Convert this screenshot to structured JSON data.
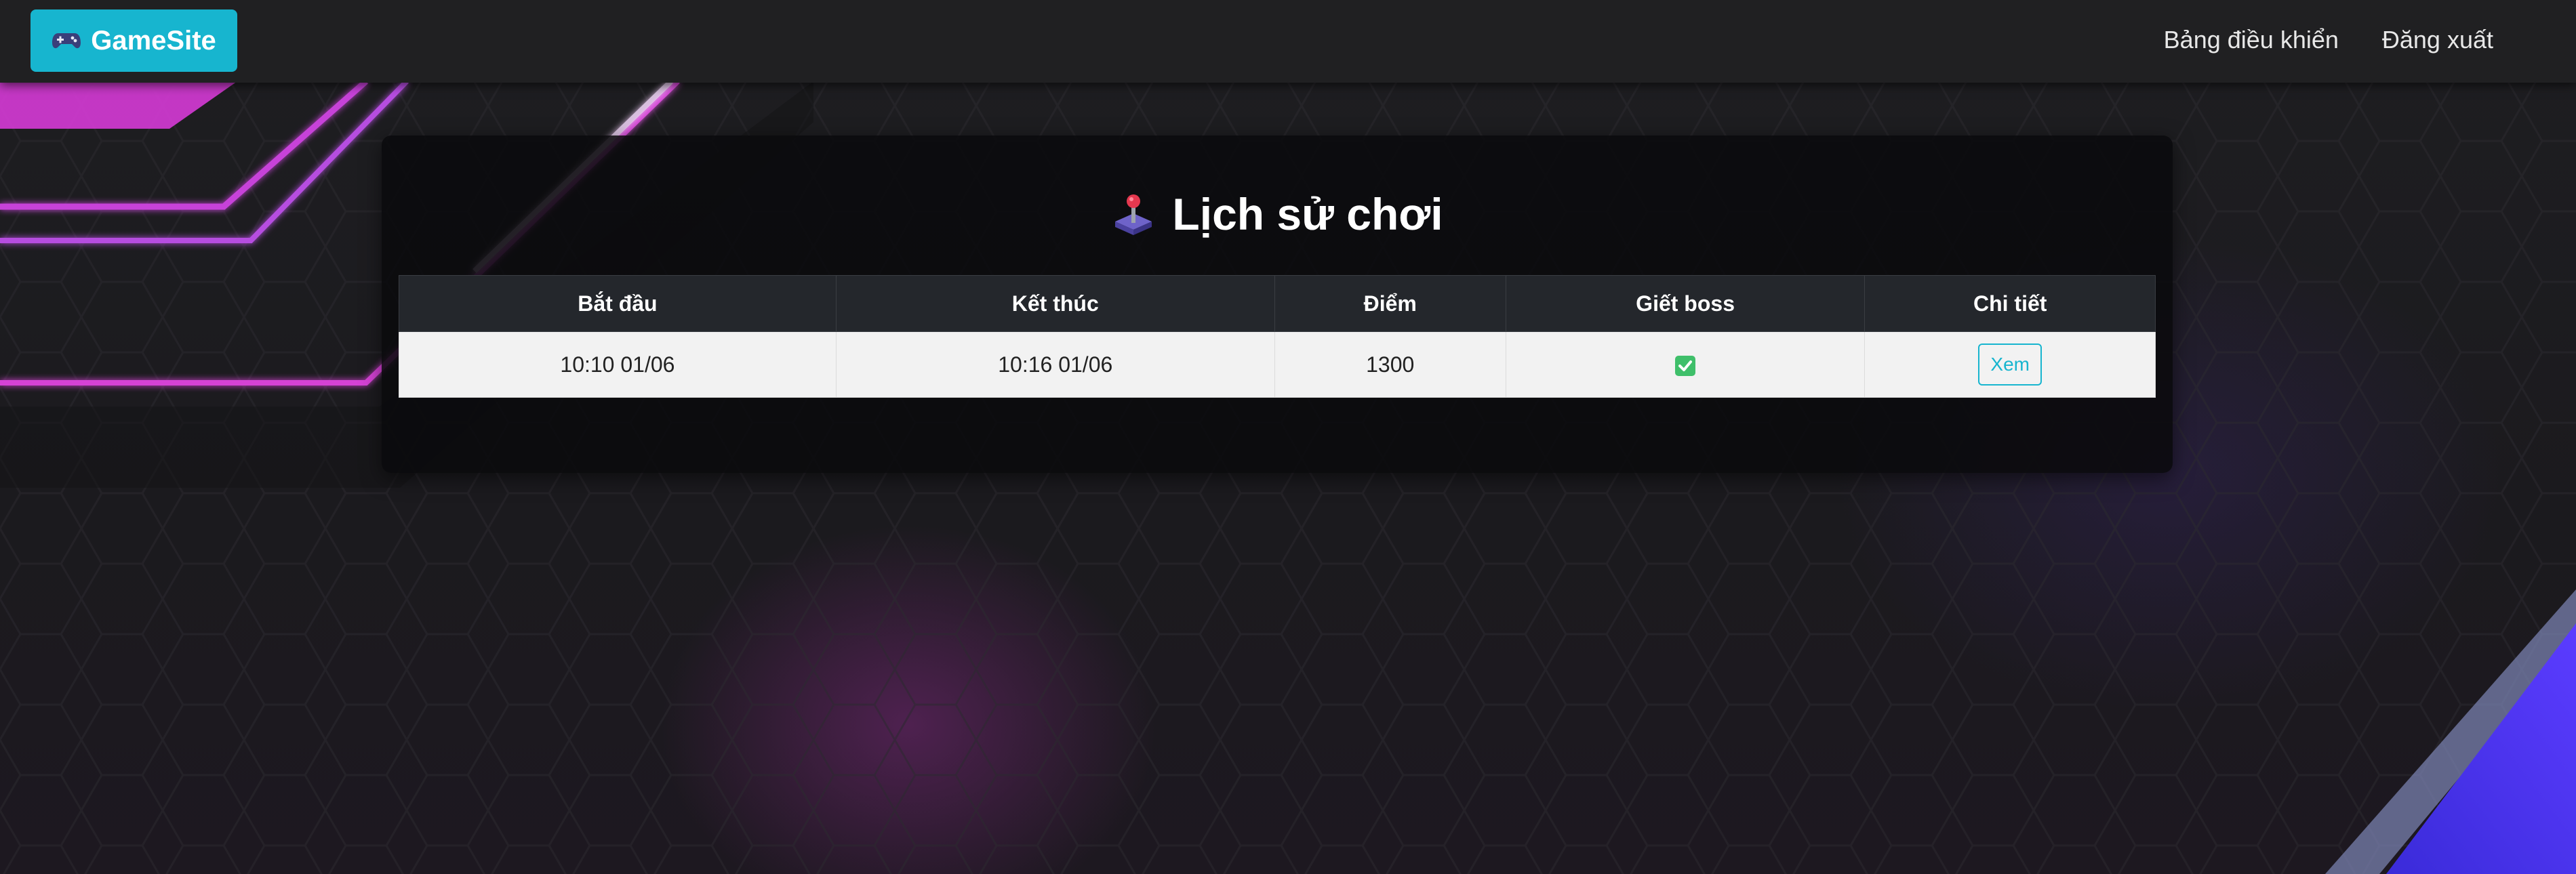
{
  "navbar": {
    "brand_label": "GameSite",
    "brand_icon": "gamepad-icon",
    "links": [
      {
        "label": "Bảng điều khiển"
      },
      {
        "label": "Đăng xuất"
      }
    ]
  },
  "page": {
    "title": "Lịch sử chơi",
    "title_icon": "joystick-icon"
  },
  "table": {
    "headers": {
      "start": "Bắt đầu",
      "end": "Kết thúc",
      "score": "Điểm",
      "boss": "Giết boss",
      "detail": "Chi tiết"
    },
    "rows": [
      {
        "start": "10:10 01/06",
        "end": "10:16 01/06",
        "score": "1300",
        "boss_killed": true,
        "boss_icon": "check-icon",
        "action_label": "Xem"
      }
    ]
  },
  "colors": {
    "accent": "#17b5cf",
    "navbar_bg": "#202022",
    "card_bg": "#0a0a0c",
    "check_green": "#3fbf6a",
    "neon_pink": "#e040fb",
    "neon_blue": "#4b3cff"
  }
}
